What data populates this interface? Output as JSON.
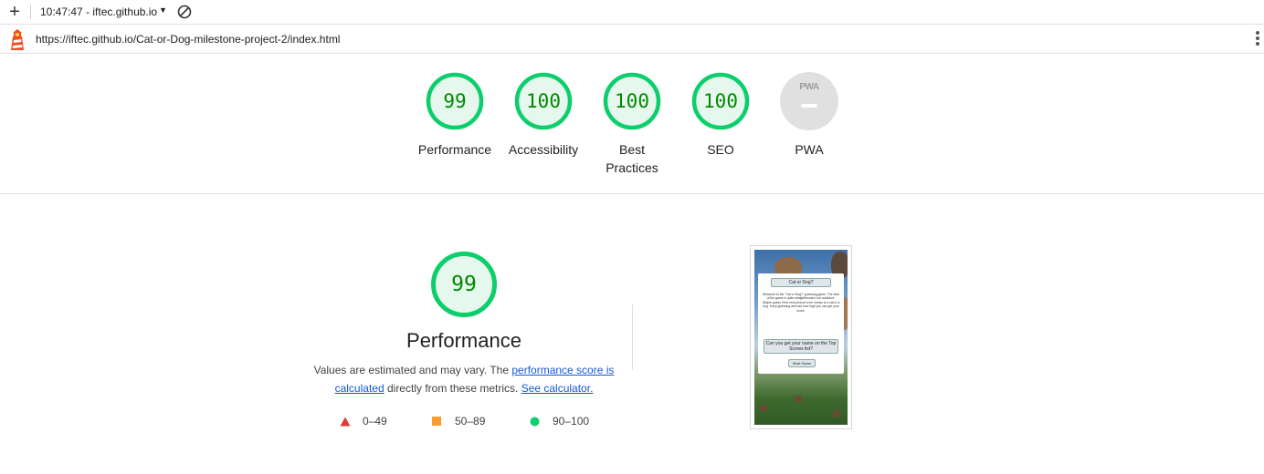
{
  "toolbar": {
    "title": "10:47:47 - iftec.github.io"
  },
  "urlbar": {
    "url": "https://iftec.github.io/Cat-or-Dog-milestone-project-2/index.html"
  },
  "gauges": [
    {
      "label": "Performance",
      "score": "99"
    },
    {
      "label": "Accessibility",
      "score": "100"
    },
    {
      "label": "Best Practices",
      "score": "100"
    },
    {
      "label": "SEO",
      "score": "100"
    },
    {
      "label": "PWA",
      "score": "PWA"
    }
  ],
  "performance": {
    "score": "99",
    "title": "Performance",
    "desc_prefix": "Values are estimated and may vary. The ",
    "link_score": "performance score is calculated",
    "desc_middle": " directly from these metrics. ",
    "link_calc": "See calculator."
  },
  "legend": [
    {
      "label": "0–49",
      "color": "#e53935",
      "shape": "triangle"
    },
    {
      "label": "50–89",
      "color": "#fa9d2e",
      "shape": "square"
    },
    {
      "label": "90–100",
      "color": "#0cce6b",
      "shape": "circle"
    }
  ],
  "colors": {
    "pass": "#0cce6b",
    "pass_bg": "#e6f8ee",
    "pass_text": "#008800",
    "link": "#1558d6"
  },
  "thumbnail": {
    "title_button": "Cat or Dog?",
    "intro": "Welcome to the \"Cat or Dog?\" guessing game. The idea of the game is quite straightforward, but addictive. Simple guess if the next picture to be shown is a cat or a dog. Keep guessing and see how high you can get your score.",
    "question_button": "Can you get your name on the Top Scores list?",
    "start_button": "Start Game"
  }
}
